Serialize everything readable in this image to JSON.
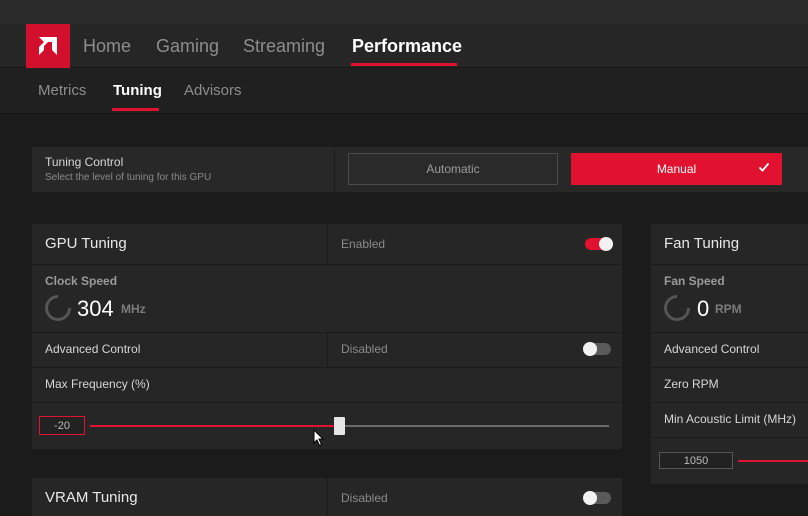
{
  "nav": {
    "tabs": [
      {
        "label": "Home"
      },
      {
        "label": "Gaming"
      },
      {
        "label": "Streaming"
      },
      {
        "label": "Performance"
      }
    ],
    "active": "Performance"
  },
  "subnav": {
    "tabs": [
      {
        "label": "Metrics"
      },
      {
        "label": "Tuning"
      },
      {
        "label": "Advisors"
      }
    ],
    "active": "Tuning"
  },
  "tuning_control": {
    "title": "Tuning Control",
    "subtitle": "Select the level of tuning for this GPU",
    "automatic_label": "Automatic",
    "manual_label": "Manual",
    "selected": "Manual"
  },
  "gpu_tuning": {
    "title": "GPU Tuning",
    "status": "Enabled",
    "enabled": true,
    "clock_label": "Clock Speed",
    "clock_value": "304",
    "clock_unit": "MHz",
    "advanced_label": "Advanced Control",
    "advanced_status": "Disabled",
    "advanced_enabled": false,
    "max_freq_label": "Max Frequency (%)",
    "max_freq_value": "-20",
    "max_freq_fraction": 0.48
  },
  "fan_tuning": {
    "title": "Fan Tuning",
    "speed_label": "Fan Speed",
    "speed_value": "0",
    "speed_unit": "RPM",
    "advanced_label": "Advanced Control",
    "zero_rpm_label": "Zero RPM",
    "min_acoustic_label": "Min Acoustic Limit (MHz)",
    "min_acoustic_value": "1050"
  },
  "vram_tuning": {
    "title": "VRAM Tuning",
    "status": "Disabled",
    "enabled": false
  },
  "colors": {
    "accent": "#e0122f",
    "background": "#1b1b1b",
    "card": "#262626"
  }
}
